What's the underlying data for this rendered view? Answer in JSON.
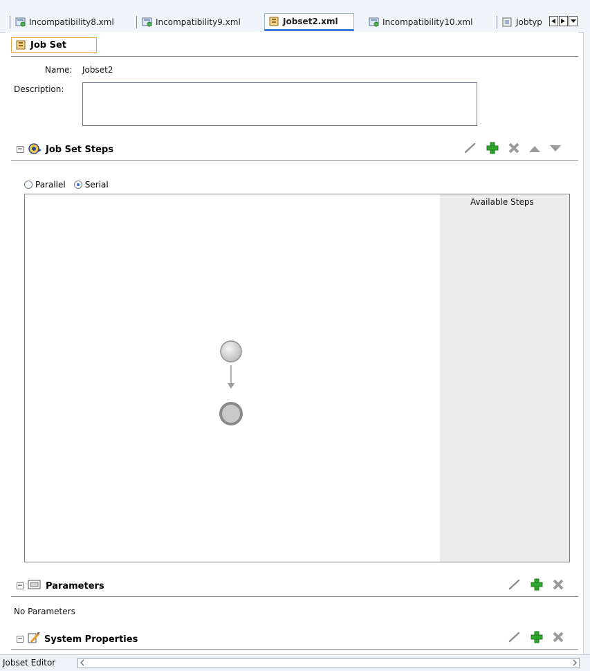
{
  "tabs": [
    {
      "label": "Incompatibility8.xml",
      "icon": "incompatibility-icon",
      "active": false
    },
    {
      "label": "Incompatibility9.xml",
      "icon": "incompatibility-icon",
      "active": false
    },
    {
      "label": "Jobset2.xml",
      "icon": "jobset-icon",
      "active": true
    },
    {
      "label": "Incompatibility10.xml",
      "icon": "incompatibility-icon",
      "active": false
    },
    {
      "label": "Jobtyp",
      "icon": "jobtype-icon",
      "active": false
    }
  ],
  "header": {
    "title": "Job Set"
  },
  "form": {
    "name_label": "Name:",
    "name_value": "Jobset2",
    "description_label": "Description:",
    "description_value": ""
  },
  "steps_section": {
    "title": "Job Set Steps",
    "mode_options": [
      "Parallel",
      "Serial"
    ],
    "selected_mode": "Serial",
    "available_steps_label": "Available Steps"
  },
  "parameters_section": {
    "title": "Parameters",
    "empty_text": "No Parameters"
  },
  "system_properties_section": {
    "title": "System Properties"
  },
  "status_bar": {
    "label": "Jobset Editor"
  },
  "colors": {
    "accent": "#3f7ad6",
    "add_green": "#2fa82f",
    "header_border": "#e6a74a"
  }
}
